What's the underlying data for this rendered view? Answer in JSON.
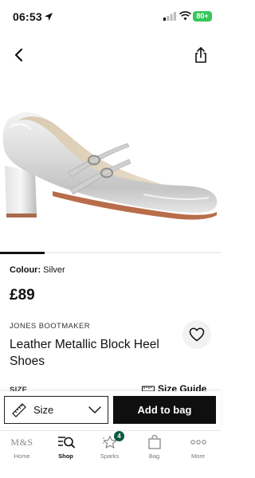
{
  "status_bar": {
    "time": "06:53",
    "battery": "80+"
  },
  "product": {
    "colour_label": "Colour:",
    "colour_value": "Silver",
    "price": "£89",
    "brand": "JONES BOOTMAKER",
    "title": "Leather Metallic Block Heel Shoes",
    "size_label": "SIZE",
    "size_guide": "Size Guide"
  },
  "actions": {
    "size_select_value": "Size",
    "add_to_bag": "Add to bag"
  },
  "tab_bar": {
    "items": [
      {
        "label": "Home",
        "logo": "M&S",
        "icon": "ms-logo"
      },
      {
        "label": "Shop",
        "icon": "shop-search-icon",
        "active": true
      },
      {
        "label": "Sparks",
        "icon": "sparks-star-icon",
        "badge": "4"
      },
      {
        "label": "Bag",
        "icon": "bag-icon"
      },
      {
        "label": "More",
        "icon": "more-dots-icon"
      }
    ]
  },
  "colors": {
    "accent": "#0f0f0f",
    "sparks_badge": "#0b5b3f",
    "battery": "#35c759"
  }
}
